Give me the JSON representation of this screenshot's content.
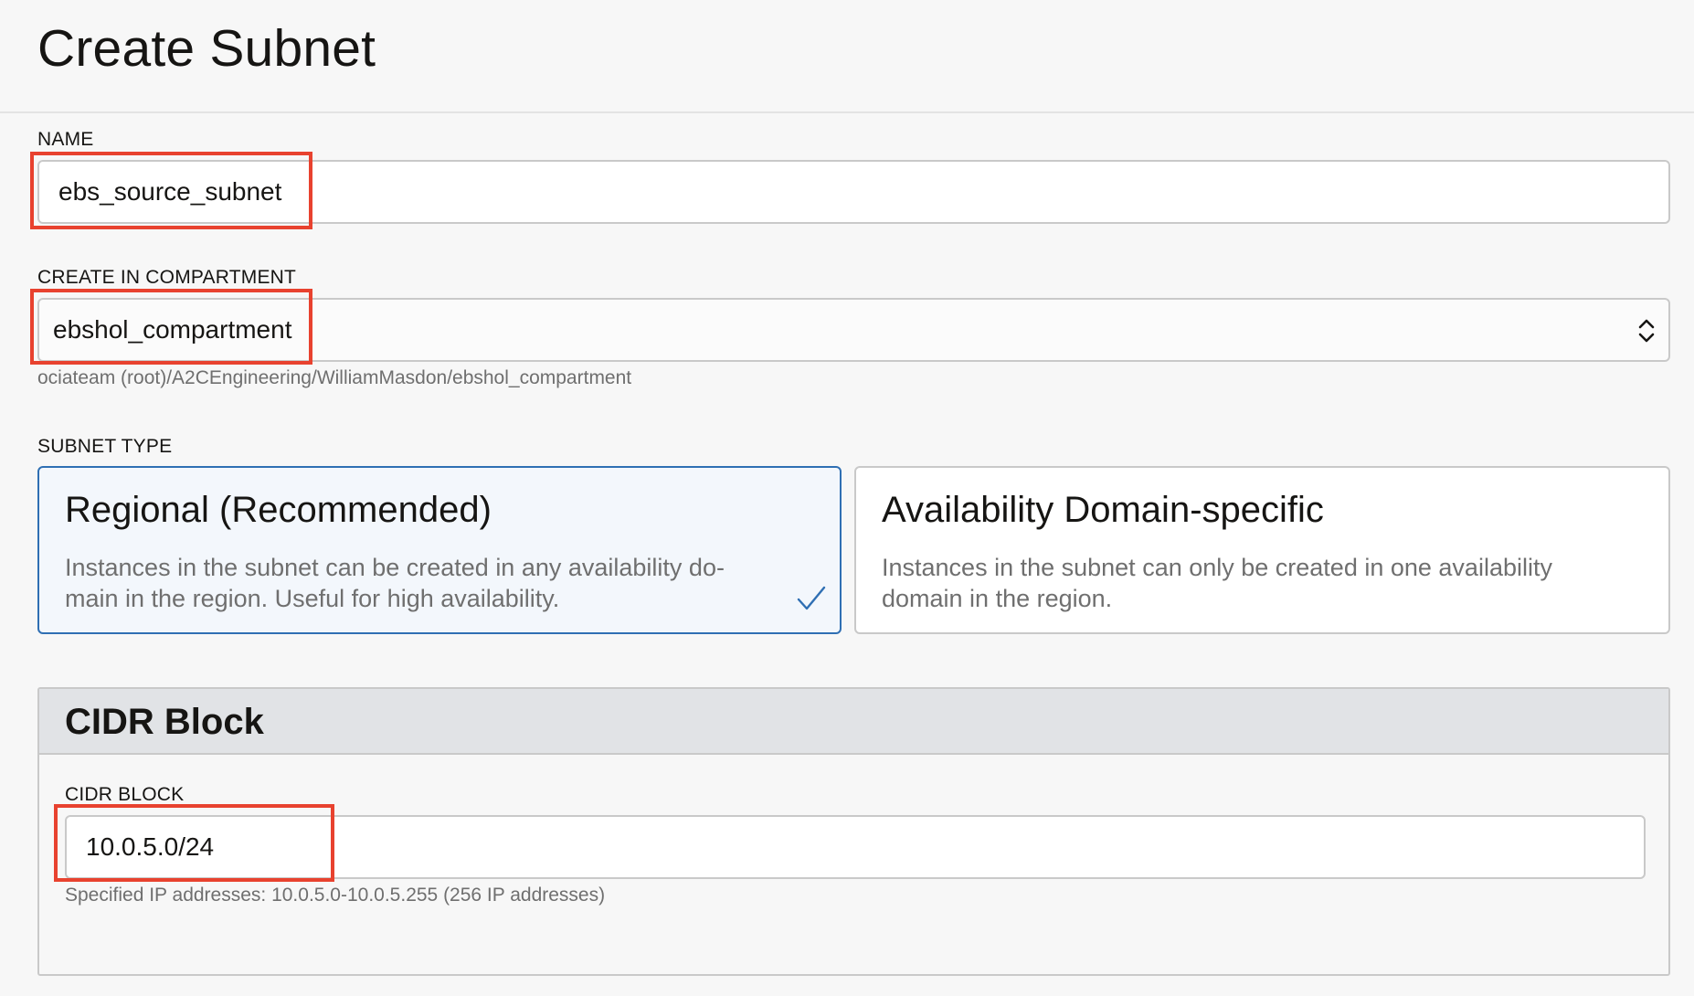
{
  "header": {
    "title": "Create Subnet"
  },
  "name_field": {
    "label": "NAME",
    "value": "ebs_source_subnet"
  },
  "compartment_field": {
    "label": "CREATE IN COMPARTMENT",
    "value": "ebshol_compartment",
    "path": "ociateam (root)/A2CEngineering/WilliamMasdon/ebshol_compartment"
  },
  "subnet_type": {
    "label": "SUBNET TYPE",
    "options": [
      {
        "title": "Regional (Recommended)",
        "desc_line1": "Instances in the subnet can be created in any availability do-",
        "desc_line2": "main in the region. Useful for high availability.",
        "selected": true
      },
      {
        "title": "Availability Domain-specific",
        "desc_line1": "Instances in the subnet can only be created in one availability",
        "desc_line2": "domain in the region.",
        "selected": false
      }
    ]
  },
  "cidr_section": {
    "title": "CIDR Block",
    "label": "CIDR BLOCK",
    "value": "10.0.5.0/24",
    "helper": "Specified IP addresses: 10.0.5.0-10.0.5.255 (256 IP addresses)"
  },
  "colors": {
    "highlight": "#e8422f",
    "selected_border": "#2f6fb3",
    "selected_bg": "#f3f7fc",
    "section_header_bg": "#e1e3e6"
  },
  "icons": {
    "select_chevron": "chevron-up-down-icon",
    "selected_check": "check-icon"
  }
}
